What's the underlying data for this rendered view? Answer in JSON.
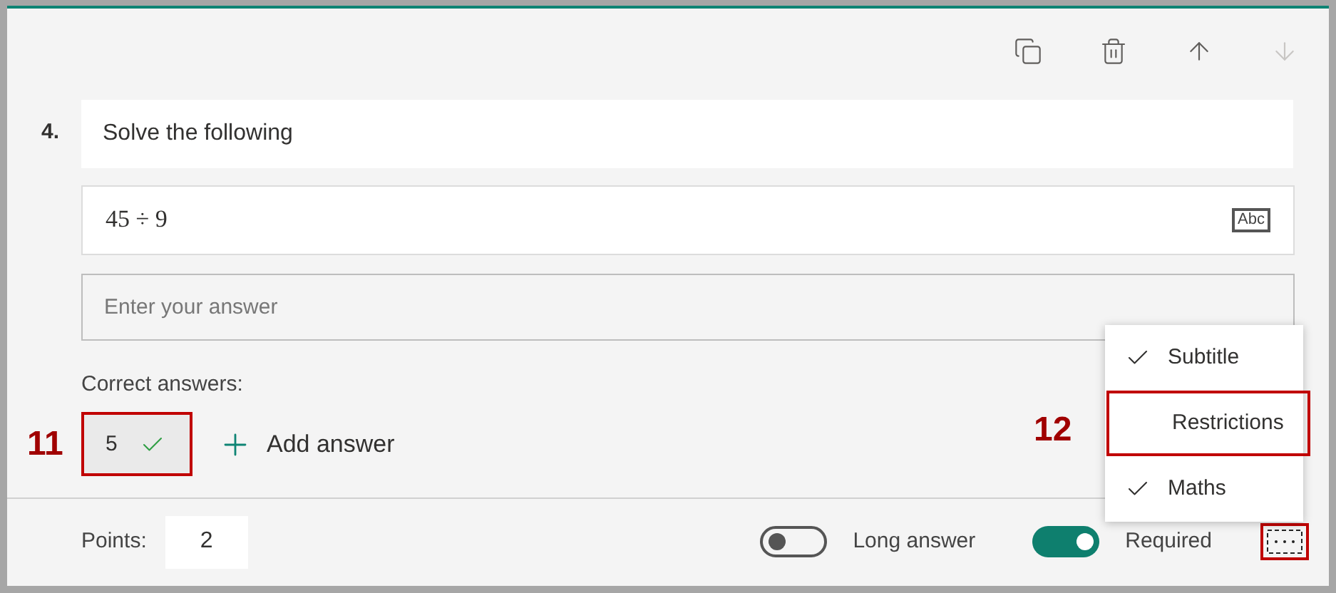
{
  "toolbar": [
    {
      "kind": "copy",
      "disabled": false
    },
    {
      "kind": "delete",
      "disabled": false
    },
    {
      "kind": "up",
      "disabled": false
    },
    {
      "kind": "down",
      "disabled": true
    }
  ],
  "question": {
    "number": "4.",
    "title": "Solve the following",
    "math": "45 ÷ 9",
    "math_badge": "Abc",
    "answer_placeholder": "Enter your answer"
  },
  "correct_answers": {
    "label": "Correct answers:",
    "answers": [
      {
        "value": "5",
        "annotation": "11"
      }
    ],
    "add_label": "Add answer"
  },
  "footer": {
    "points_label": "Points:",
    "points": "2",
    "toggles": [
      {
        "label": "Long answer",
        "on": false
      },
      {
        "label": "Required",
        "on": true
      }
    ],
    "more_highlighted": true
  },
  "menu": {
    "items": [
      {
        "label": "Subtitle",
        "checked": true,
        "highlighted": false
      },
      {
        "label": "Restrictions",
        "checked": false,
        "highlighted": true,
        "annotation": "12"
      },
      {
        "label": "Maths",
        "checked": true,
        "highlighted": false
      }
    ]
  }
}
